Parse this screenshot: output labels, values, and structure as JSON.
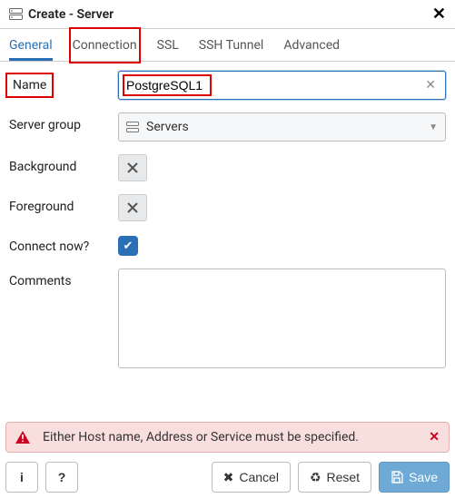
{
  "window": {
    "title": "Create - Server"
  },
  "tabs": {
    "general": "General",
    "connection": "Connection",
    "ssl": "SSL",
    "ssh": "SSH Tunnel",
    "advanced": "Advanced"
  },
  "form": {
    "labels": {
      "name": "Name",
      "server_group": "Server group",
      "background": "Background",
      "foreground": "Foreground",
      "connect_now": "Connect now?",
      "comments": "Comments"
    },
    "name_value": "PostgreSQL1",
    "server_group_value": "Servers",
    "connect_now_checked": "✔",
    "comments_value": ""
  },
  "alert": {
    "message": "Either Host name, Address or Service must be specified."
  },
  "buttons": {
    "info": "i",
    "help": "?",
    "cancel": "Cancel",
    "reset": "Reset",
    "save": "Save"
  }
}
